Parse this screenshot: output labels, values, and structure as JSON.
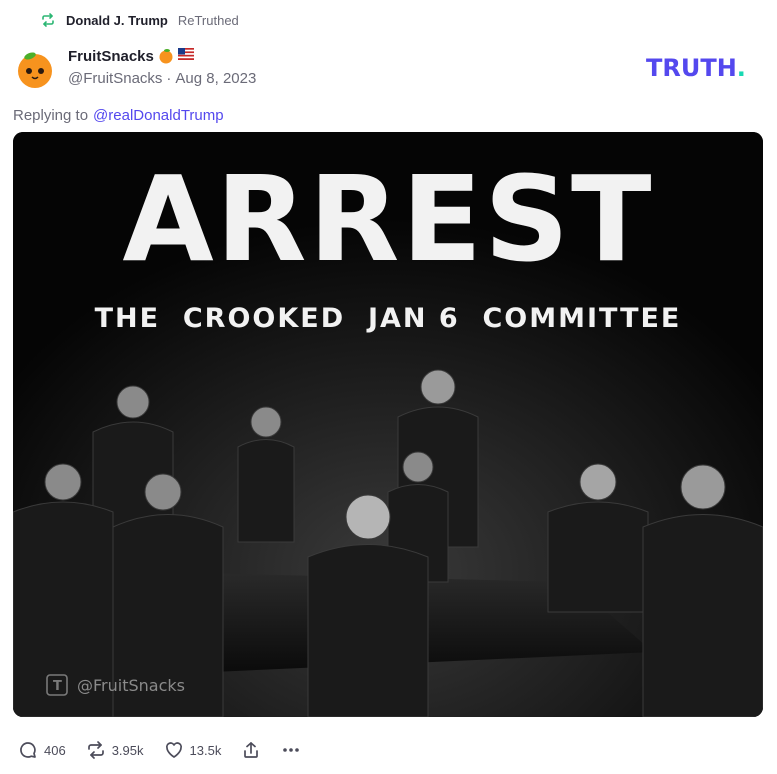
{
  "retruth": {
    "name": "Donald J. Trump",
    "label": "ReTruthed",
    "icon": "retruth-icon",
    "icon_color": "#2bb673"
  },
  "post": {
    "display_name": "FruitSnacks",
    "name_emojis": [
      "orange-emoji",
      "us-flag-emoji"
    ],
    "handle": "@FruitSnacks",
    "separator": "·",
    "date": "Aug 8, 2023",
    "avatar": "orange-mascot-avatar",
    "reply_prefix": "Replying to",
    "reply_mention": "@realDonaldTrump",
    "brand": "TRUTH.",
    "brand_color": "#5448ee",
    "brand_dot_color": "#18d9b3"
  },
  "image": {
    "headline": "ARREST",
    "subheadline": "THE  CROOKED  JAN 6  COMMITTEE",
    "watermark": "@FruitSnacks"
  },
  "actions": {
    "replies": "406",
    "retruths": "3.95k",
    "likes": "13.5k",
    "share_icon": "share-icon",
    "more_icon": "more-icon"
  }
}
